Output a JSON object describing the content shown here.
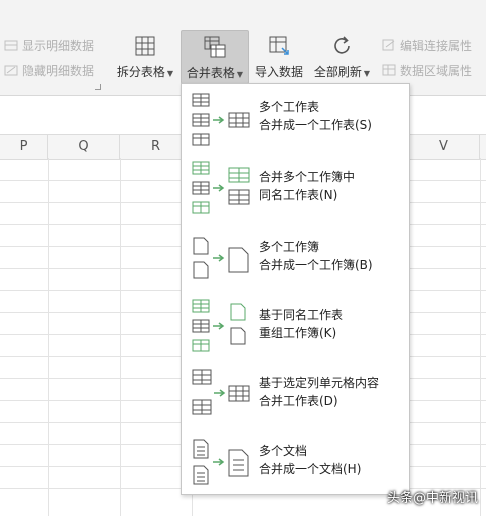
{
  "ribbon": {
    "show_detail": "显示明细数据",
    "hide_detail": "隐藏明细数据",
    "split_table": "拆分表格",
    "merge_table": "合并表格",
    "import_data": "导入数据",
    "refresh_all": "全部刷新",
    "edit_connection": "编辑连接属性",
    "range_property": "数据区域属性"
  },
  "columns": [
    "P",
    "Q",
    "R",
    "V"
  ],
  "menu": [
    {
      "line1": "多个工作表",
      "line2": "合并成一个工作表(S)"
    },
    {
      "line1": "合并多个工作簿中",
      "line2": "同名工作表(N)"
    },
    {
      "line1": "多个工作簿",
      "line2": "合并成一个工作簿(B)"
    },
    {
      "line1": "基于同名工作表",
      "line2": "重组工作簿(K)"
    },
    {
      "line1": "基于选定列单元格内容",
      "line2": "合并工作表(D)"
    },
    {
      "line1": "多个文档",
      "line2": "合并成一个文档(H)"
    }
  ],
  "watermark": "头条@中新视讯",
  "colors": {
    "accent_green": "#5aa86a",
    "ribbon_bg": "#f3f3f3",
    "active_bg": "#cdcdcd"
  }
}
